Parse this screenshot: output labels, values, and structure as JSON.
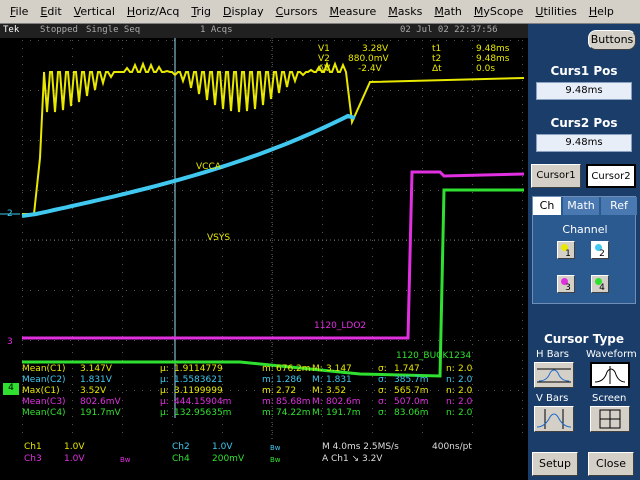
{
  "menu": [
    "File",
    "Edit",
    "Vertical",
    "Horiz/Acq",
    "Trig",
    "Display",
    "Cursors",
    "Measure",
    "Masks",
    "Math",
    "MyScope",
    "Utilities",
    "Help"
  ],
  "status": {
    "brand": "Tek",
    "state": "Stopped",
    "mode": "Single Seq",
    "acqs": "1 Acqs",
    "datetime": "02 Jul 02 22:37:56"
  },
  "cursor_readout": {
    "v1_label": "V1",
    "v1_value": "3.28V",
    "v2_label": "V2",
    "v2_value": "880.0mV",
    "dv_label": "ΔV",
    "dv_value": "-2.4V",
    "t1_label": "t1",
    "t1_value": "9.48ms",
    "t2_label": "t2",
    "t2_value": "9.48ms",
    "dt_label": "Δt",
    "dt_value": "0.0s"
  },
  "trace_labels": {
    "vcca": "VCCA",
    "vsys": "VSYS",
    "ldo": "1120_LDO2",
    "buck": "1120_BUCK1234"
  },
  "markers": {
    "ch2": "2",
    "ch3": "3",
    "ch4": "4"
  },
  "measurements": [
    {
      "name": "Mean(C1)",
      "value": "3.147V",
      "mu": "1.9114779",
      "m": "676.2m",
      "M": "3.147",
      "sigma": "1.747",
      "n": "2.0",
      "color": "#e8e800"
    },
    {
      "name": "Mean(C2)",
      "value": "1.831V",
      "mu": "1.5583621",
      "m": "1.286",
      "M": "1.831",
      "sigma": "385.7m",
      "n": "2.0",
      "color": "#40c8f0"
    },
    {
      "name": "Max(C1)",
      "value": "3.52V",
      "mu": "3.1199999",
      "m": "2.72",
      "M": "3.52",
      "sigma": "565.7m",
      "n": "2.0",
      "color": "#e8e800"
    },
    {
      "name": "Mean(C3)",
      "value": "802.6mV",
      "mu": "444.15904m",
      "m": "85.68m",
      "M": "802.6m",
      "sigma": "507.0m",
      "n": "2.0",
      "color": "#e030e0"
    },
    {
      "name": "Mean(C4)",
      "value": "191.7mV",
      "mu": "132.95635m",
      "m": "74.22m",
      "M": "191.7m",
      "sigma": "83.06m",
      "n": "2.0",
      "color": "#30e030"
    }
  ],
  "stat_labels": {
    "mu": "μ:",
    "m": "m:",
    "M": "M:",
    "sigma": "σ:",
    "n": "n:"
  },
  "channels": [
    {
      "name": "Ch1",
      "scale": "1.0V",
      "color": "#e8e800"
    },
    {
      "name": "Ch2",
      "scale": "1.0V",
      "color": "#40c8f0"
    },
    {
      "name": "Ch3",
      "scale": "1.0V",
      "color": "#e030e0"
    },
    {
      "name": "Ch4",
      "scale": "200mV",
      "color": "#30e030"
    }
  ],
  "bw_label": "Bw",
  "timebase": {
    "scale": "M 4.0ms 2.5MS/s",
    "pt": "400ns/pt",
    "trigger": "A  Ch1  ↘ 3.2V"
  },
  "panel": {
    "buttons": "Buttons",
    "curs1_title": "Curs1 Pos",
    "curs1_value": "9.48ms",
    "curs2_title": "Curs2 Pos",
    "curs2_value": "9.48ms",
    "cursor1": "Cursor1",
    "cursor2": "Cursor2",
    "tabs": [
      "Ch",
      "Math",
      "Ref"
    ],
    "channel_title": "Channel",
    "channel_btns": [
      "1",
      "2",
      "3",
      "4"
    ],
    "cursor_type_title": "Cursor Type",
    "hbars": "H Bars",
    "waveform": "Waveform",
    "vbars": "V Bars",
    "screen": "Screen",
    "setup": "Setup",
    "close": "Close"
  },
  "colors": {
    "ch1": "#e8e800",
    "ch2": "#40c8f0",
    "ch3": "#e030e0",
    "ch4": "#30e030",
    "panel": "#1a3d6a"
  }
}
